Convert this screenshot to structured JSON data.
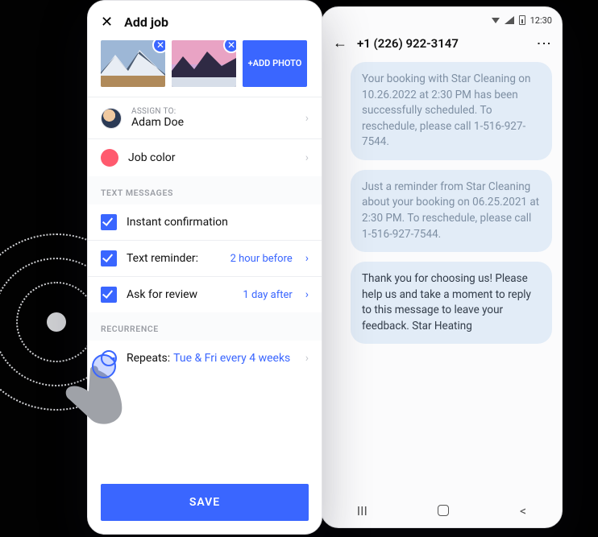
{
  "status_time": "12:30",
  "sms": {
    "contact": "+1 (226) 922-3147",
    "messages": [
      "Your booking with Star Cleaning on 10.26.2022 at 2:30 PM has been successfully scheduled. To reschedule, please call 1-516-927-7544.",
      "Just a reminder from Star Cleaning about your booking on 06.25.2021 at 2:30 PM. To reschedule, please call 1-516-927-7544.",
      "Thank you for choosing us! Please help us and take a moment to reply to this message to leave your feedback. Star Heating"
    ]
  },
  "job": {
    "screen_title": "Add job",
    "add_photo_label": "+ADD PHOTO",
    "assign_label": "ASSIGN TO:",
    "assignee": "Adam Doe",
    "job_color_label": "Job color",
    "sections": {
      "text_messages": "TEXT MESSAGES",
      "recurrence": "RECURRENCE"
    },
    "options": {
      "instant_confirmation": "Instant confirmation",
      "text_reminder_label": "Text reminder:",
      "text_reminder_value": "2 hour before",
      "ask_review_label": "Ask for review",
      "ask_review_value": "1 day after"
    },
    "repeats_label": "Repeats:",
    "repeats_value": "Tue & Fri every 4 weeks",
    "save": "SAVE"
  }
}
